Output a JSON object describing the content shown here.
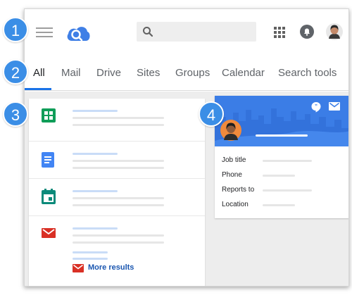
{
  "badges": [
    "1",
    "2",
    "3",
    "4"
  ],
  "tabs": [
    "All",
    "Mail",
    "Drive",
    "Sites",
    "Groups",
    "Calendar",
    "Search tools"
  ],
  "results": {
    "items": [
      {
        "icon": "sheets-icon",
        "color": "#0f9d58"
      },
      {
        "icon": "docs-icon",
        "color": "#4285f4"
      },
      {
        "icon": "calendar-icon",
        "color": "#0b8a7a"
      },
      {
        "icon": "gmail-icon",
        "color": "#d93025"
      }
    ],
    "more_label": "More results"
  },
  "profile_card": {
    "fields": [
      "Job title",
      "Phone",
      "Reports to",
      "Location"
    ]
  },
  "colors": {
    "accent": "#1a73e8",
    "badge": "#3b8ee6",
    "card_header": "#3b7de6"
  }
}
